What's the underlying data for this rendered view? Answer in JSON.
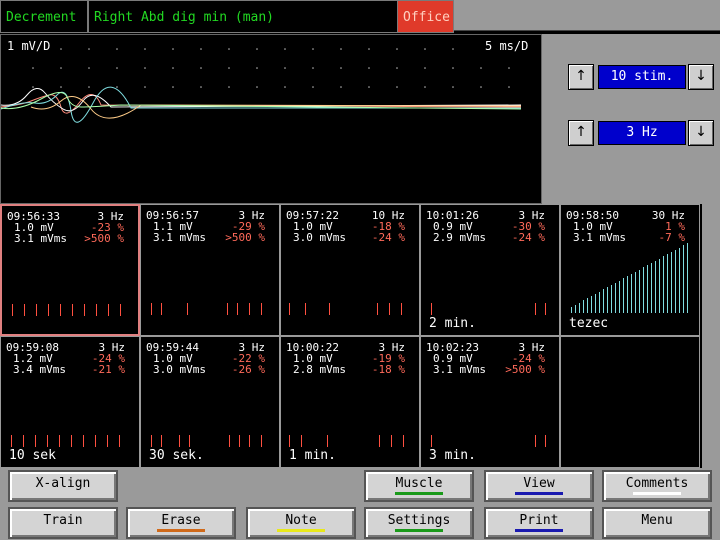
{
  "topbar": {
    "mode": "Decrement",
    "muscle": "Right Abd dig min (man)",
    "location": "Office"
  },
  "waveform": {
    "amp_scale": "1 mV/D",
    "time_scale": "5 ms/D"
  },
  "controls": {
    "stim_count": "10 stim.",
    "frequency": "3 Hz",
    "up_icon": "up-arrow-icon",
    "down_icon": "down-arrow-icon"
  },
  "trials": [
    {
      "time": "09:56:33",
      "freq": "3 Hz",
      "amp": "1.0 mV",
      "amp_pct": "-23 %",
      "area": "3.1 mVms",
      "area_pct": ">500 %",
      "label": ""
    },
    {
      "time": "09:56:57",
      "freq": "3 Hz",
      "amp": "1.1 mV",
      "amp_pct": "-29 %",
      "area": "3.1 mVms",
      "area_pct": ">500 %",
      "label": ""
    },
    {
      "time": "09:57:22",
      "freq": "10 Hz",
      "amp": "1.0 mV",
      "amp_pct": "-18 %",
      "area": "3.0 mVms",
      "area_pct": "-24 %",
      "label": ""
    },
    {
      "time": "10:01:26",
      "freq": "3 Hz",
      "amp": "0.9 mV",
      "amp_pct": "-30 %",
      "area": "2.9 mVms",
      "area_pct": "-24 %",
      "label": "2 min."
    },
    {
      "time": "09:58:50",
      "freq": "30 Hz",
      "amp": "1.0 mV",
      "amp_pct": "1 %",
      "area": "3.1 mVms",
      "area_pct": "-7 %",
      "label": "tezec"
    },
    {
      "time": "09:59:08",
      "freq": "3 Hz",
      "amp": "1.2 mV",
      "amp_pct": "-24 %",
      "area": "3.4 mVms",
      "area_pct": "-21 %",
      "label": "10 sek"
    },
    {
      "time": "09:59:44",
      "freq": "3 Hz",
      "amp": "1.0 mV",
      "amp_pct": "-22 %",
      "area": "3.0 mVms",
      "area_pct": "-26 %",
      "label": "30 sek."
    },
    {
      "time": "10:00:22",
      "freq": "3 Hz",
      "amp": "1.0 mV",
      "amp_pct": "-19 %",
      "area": "2.8 mVms",
      "area_pct": "-18 %",
      "label": "1 min."
    },
    {
      "time": "10:02:23",
      "freq": "3 Hz",
      "amp": "0.9 mV",
      "amp_pct": "-24 %",
      "area": "3.1 mVms",
      "area_pct": ">500 %",
      "label": "3 min."
    }
  ],
  "buttons": {
    "x_align": "X-align",
    "muscle": "Muscle",
    "view": "View",
    "comments": "Comments",
    "train": "Train",
    "erase": "Erase",
    "note": "Note",
    "settings": "Settings",
    "print": "Print",
    "menu": "Menu"
  },
  "colors": {
    "topbar_text": "#22d822",
    "office_bg": "#e03a2a",
    "value_box": "#0000cc",
    "pct_text": "#ff6a5a",
    "muscle_bar": "#1a9a1a",
    "view_bar": "#1a1ab0",
    "comments_bar": "#ffffff",
    "erase_bar": "#d06a1a",
    "note_bar": "#e8e81a",
    "settings_bar": "#1a9a1a",
    "print_bar": "#1a1ab0"
  }
}
